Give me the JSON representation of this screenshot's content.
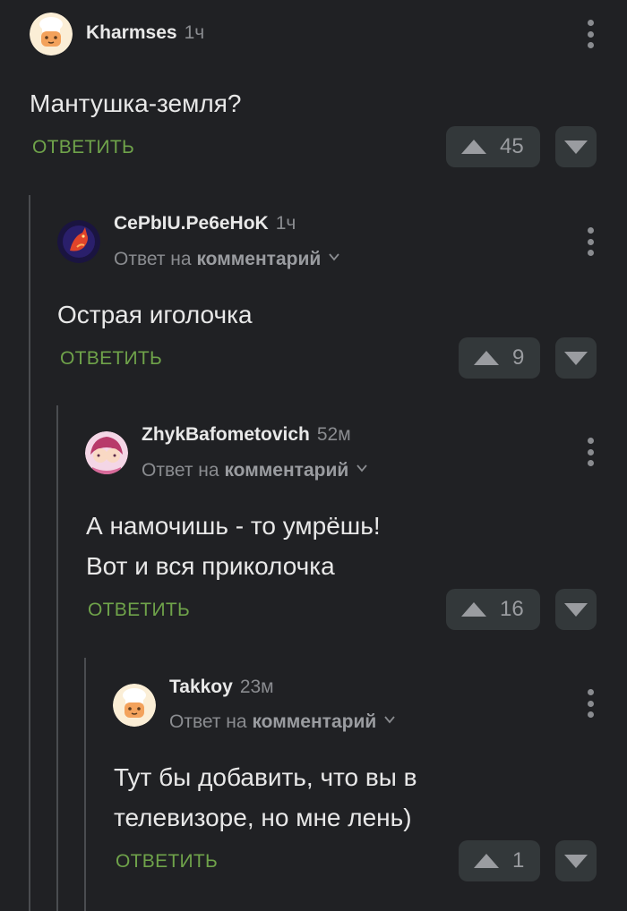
{
  "comments": [
    {
      "author": "Kharmses",
      "time": "1ч",
      "reply_prefix": "",
      "reply_target": "",
      "text_lines": [
        "Мантушка-земля?"
      ],
      "reply_label": "ОТВЕТИТЬ",
      "votes": "45",
      "avatar": "chef-avatar"
    },
    {
      "author": "CePbIU.Pe6eHoK",
      "time": "1ч",
      "reply_prefix": "Ответ на",
      "reply_target": "комментарий",
      "text_lines": [
        "Острая иголочка"
      ],
      "reply_label": "ОТВЕТИТЬ",
      "votes": "9",
      "avatar": "fox-avatar"
    },
    {
      "author": "ZhykBafometovich",
      "time": "52м",
      "reply_prefix": "Ответ на",
      "reply_target": "комментарий",
      "text_lines": [
        "А намочишь - то умрёшь!",
        "Вот и вся приколочка"
      ],
      "reply_label": "ОТВЕТИТЬ",
      "votes": "16",
      "avatar": "anime-avatar"
    },
    {
      "author": "Takkoy",
      "time": "23м",
      "reply_prefix": "Ответ на",
      "reply_target": "комментарий",
      "text_lines": [
        "Тут бы добавить, что вы в",
        "телевизоре, но мне лень)"
      ],
      "reply_label": "ОТВЕТИТЬ",
      "votes": "1",
      "avatar": "chef-avatar"
    }
  ],
  "colors": {
    "background": "#202124",
    "reply_green": "#6fa34a",
    "vote_bg": "#33383a",
    "muted": "#8a8c90"
  }
}
